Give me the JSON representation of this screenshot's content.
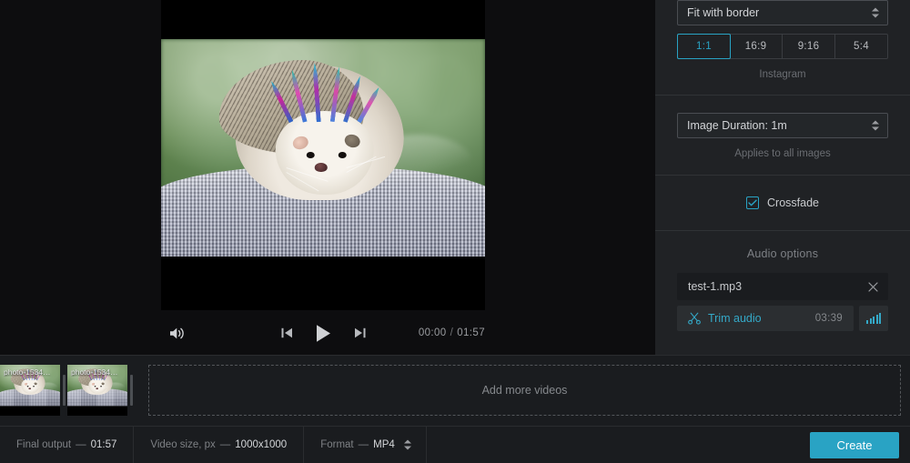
{
  "preview": {
    "controls": {
      "volume_icon": "volume-icon",
      "prev_icon": "skip-previous-icon",
      "play_icon": "play-icon",
      "next_icon": "skip-next-icon",
      "current_time": "00:00",
      "time_separator": "/",
      "total_time": "01:57"
    }
  },
  "side_panel": {
    "fit_mode": {
      "value": "Fit with border",
      "icon": "spinner-arrows-icon"
    },
    "aspect_ratios": [
      {
        "label": "1:1",
        "active": true
      },
      {
        "label": "16:9",
        "active": false
      },
      {
        "label": "9:16",
        "active": false
      },
      {
        "label": "5:4",
        "active": false
      }
    ],
    "aspect_hint": "Instagram",
    "image_duration": {
      "value": "Image Duration: 1m",
      "hint": "Applies to all images"
    },
    "crossfade": {
      "label": "Crossfade",
      "checked": true,
      "icon": "checkmark-icon"
    },
    "audio": {
      "title": "Audio options",
      "file_name": "test-1.mp3",
      "remove_icon": "close-icon",
      "trim_label": "Trim audio",
      "trim_icon": "scissors-icon",
      "duration": "03:39",
      "equalizer_icon": "equalizer-icon"
    }
  },
  "timeline": {
    "clips": [
      {
        "name": "photo-1534…"
      },
      {
        "name": "photo-1534…"
      }
    ],
    "dropzone_label": "Add more videos"
  },
  "status_bar": {
    "items": [
      {
        "label": "Final output",
        "dash": "—",
        "value": "01:57"
      },
      {
        "label": "Video size, px",
        "dash": "—",
        "value": "1000x1000"
      },
      {
        "label": "Format",
        "dash": "—",
        "value": "MP4",
        "has_spinner": true
      }
    ],
    "create_label": "Create"
  },
  "colors": {
    "accent": "#29a3c4",
    "panel_bg": "#202225",
    "app_bg": "#0d0d0f",
    "timeline_bg": "#1a1c1f"
  }
}
